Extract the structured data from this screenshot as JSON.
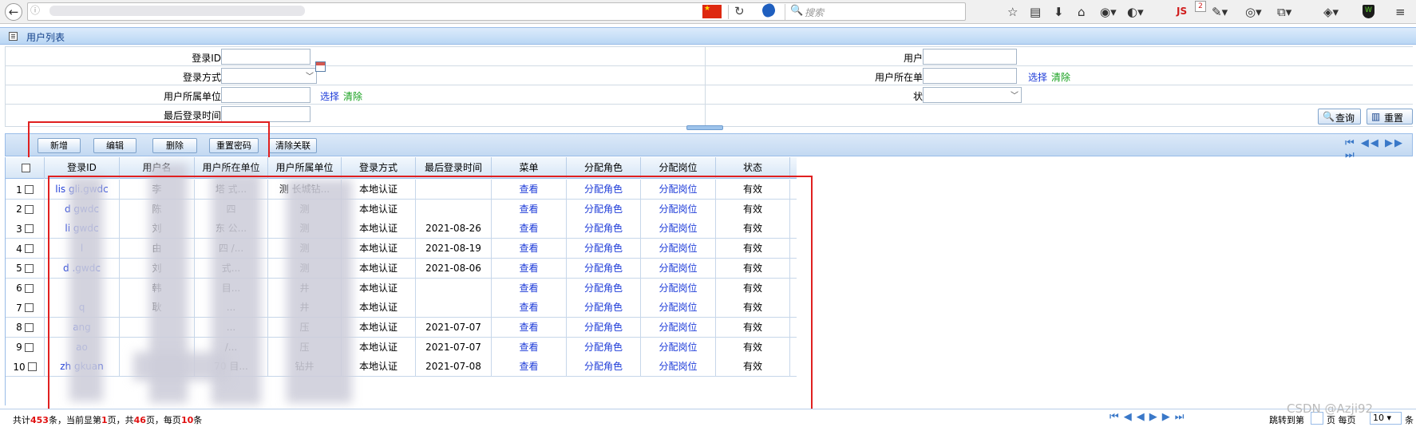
{
  "browser": {
    "search_placeholder": "搜索",
    "js_badge": "JS",
    "js_count": "2"
  },
  "panel": {
    "title": "用户列表"
  },
  "form": {
    "login_id_label": "登录ID",
    "username_label": "用户名",
    "login_method_label": "登录方式",
    "user_unit_label": "用户所在单位",
    "user_belong_unit_label": "用户所属单位",
    "status_label": "状态",
    "last_login_label": "最后登录时间",
    "select_link": "选择",
    "clear_link": "清除",
    "query_button": "查询",
    "reset_button": "重置"
  },
  "toolbar": {
    "add": "新增",
    "edit": "编辑",
    "delete": "删除",
    "reset_password": "重置密码",
    "clear_assoc": "清除关联"
  },
  "grid": {
    "headers": [
      "登录ID",
      "用户名",
      "用户所在单位",
      "用户所属单位",
      "登录方式",
      "最后登录时间",
      "菜单",
      "分配角色",
      "分配岗位",
      "状态"
    ],
    "rows": [
      {
        "idx": "1",
        "login_id": "lis     gli.gwdc",
        "name": "李",
        "unit": "塔      式...",
        "belong": "测      长城钻...",
        "method": "本地认证",
        "last": "",
        "menu": "查看",
        "role": "分配角色",
        "post": "分配岗位",
        "status": "有效"
      },
      {
        "idx": "2",
        "login_id": "d     gwdc",
        "name": "陈",
        "unit": "四",
        "belong": "测",
        "method": "本地认证",
        "last": "",
        "menu": "查看",
        "role": "分配角色",
        "post": "分配岗位",
        "status": "有效"
      },
      {
        "idx": "3",
        "login_id": "li     gwdc",
        "name": "刘",
        "unit": "东      公...",
        "belong": "测",
        "method": "本地认证",
        "last": "2021-08-26",
        "menu": "查看",
        "role": "分配角色",
        "post": "分配岗位",
        "status": "有效"
      },
      {
        "idx": "4",
        "login_id": "l",
        "name": "由",
        "unit": "四      /...",
        "belong": "测",
        "method": "本地认证",
        "last": "2021-08-19",
        "menu": "查看",
        "role": "分配角色",
        "post": "分配岗位",
        "status": "有效"
      },
      {
        "idx": "5",
        "login_id": "d     .gwdc",
        "name": "刘",
        "unit": "      式...",
        "belong": "测",
        "method": "本地认证",
        "last": "2021-08-06",
        "menu": "查看",
        "role": "分配角色",
        "post": "分配岗位",
        "status": "有效"
      },
      {
        "idx": "6",
        "login_id": "",
        "name": "韩",
        "unit": "      目...",
        "belong": "井",
        "method": "本地认证",
        "last": "",
        "menu": "查看",
        "role": "分配角色",
        "post": "分配岗位",
        "status": "有效"
      },
      {
        "idx": "7",
        "login_id": "q",
        "name": "耿",
        "unit": "...",
        "belong": "井",
        "method": "本地认证",
        "last": "",
        "menu": "查看",
        "role": "分配角色",
        "post": "分配岗位",
        "status": "有效"
      },
      {
        "idx": "8",
        "login_id": "ang",
        "name": "",
        "unit": "...",
        "belong": "压",
        "method": "本地认证",
        "last": "2021-07-07",
        "menu": "查看",
        "role": "分配角色",
        "post": "分配岗位",
        "status": "有效"
      },
      {
        "idx": "9",
        "login_id": "ao",
        "name": "",
        "unit": "/...",
        "belong": "压",
        "method": "本地认证",
        "last": "2021-07-07",
        "menu": "查看",
        "role": "分配角色",
        "post": "分配岗位",
        "status": "有效"
      },
      {
        "idx": "10",
        "login_id": "zh     gkuan",
        "name": "",
        "unit": "70      目...",
        "belong": "钻井",
        "method": "本地认证",
        "last": "2021-07-08",
        "menu": "查看",
        "role": "分配角色",
        "post": "分配岗位",
        "status": "有效"
      }
    ]
  },
  "footer": {
    "total_prefix": "共计",
    "total": "453",
    "total_suffix": "条，当前显第",
    "page": "1",
    "page_suffix": "页，共",
    "pages": "46",
    "pages_suffix": "页，每页",
    "per_page": "10",
    "per_suffix": "条",
    "jump_label": "跳转到第",
    "jump_suffix": "页 每页",
    "per_select": "10",
    "per_tail": "条"
  },
  "watermark": "CSDN @Azji92"
}
